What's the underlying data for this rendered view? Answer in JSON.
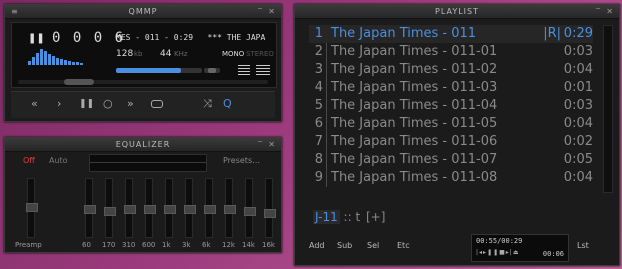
{
  "main": {
    "title": "QMMP",
    "time": [
      "0",
      "0",
      "0",
      "6"
    ],
    "marquee": "MES - 011 - 0:29   *** THE JAPA",
    "bitrate": "128",
    "bitrate_unit": "kb",
    "samplerate": "44",
    "samplerate_unit": "KHz",
    "mono": "MONO",
    "stereo": "STEREO",
    "position_fraction": 0.2,
    "volume_fraction": 0.75,
    "accent": "#4a8fe0"
  },
  "equalizer": {
    "title": "EQUALIZER",
    "off": "Off",
    "auto": "Auto",
    "presets": "Presets",
    "preamp": "Preamp",
    "bands": [
      "60",
      "170",
      "310",
      "600",
      "1k",
      "3k",
      "6k",
      "12k",
      "14k",
      "16k"
    ]
  },
  "playlist": {
    "title": "PLAYLIST",
    "tracks": [
      {
        "num": "1",
        "title": "The Japan Times - 011",
        "dur": "0:29",
        "flag": "|R|"
      },
      {
        "num": "2",
        "title": "The Japan Times - 011-01",
        "dur": "0:03"
      },
      {
        "num": "3",
        "title": "The Japan Times - 011-02",
        "dur": "0:04"
      },
      {
        "num": "4",
        "title": "The Japan Times - 011-03",
        "dur": "0:01"
      },
      {
        "num": "5",
        "title": "The Japan Times - 011-04",
        "dur": "0:03"
      },
      {
        "num": "6",
        "title": "The Japan Times - 011-05",
        "dur": "0:04"
      },
      {
        "num": "7",
        "title": "The Japan Times - 011-06",
        "dur": "0:02"
      },
      {
        "num": "8",
        "title": "The Japan Times - 011-07",
        "dur": "0:05"
      },
      {
        "num": "9",
        "title": "The Japan Times - 011-08",
        "dur": "0:04"
      }
    ],
    "status_tab": "J-11",
    "status_mid": ":: t",
    "status_add": "[+]",
    "buttons": [
      "Add",
      "Sub",
      "Sel",
      "Etc",
      "Lst"
    ],
    "mini_time": "00:55/00:29",
    "mini_elapsed": "00:06"
  }
}
